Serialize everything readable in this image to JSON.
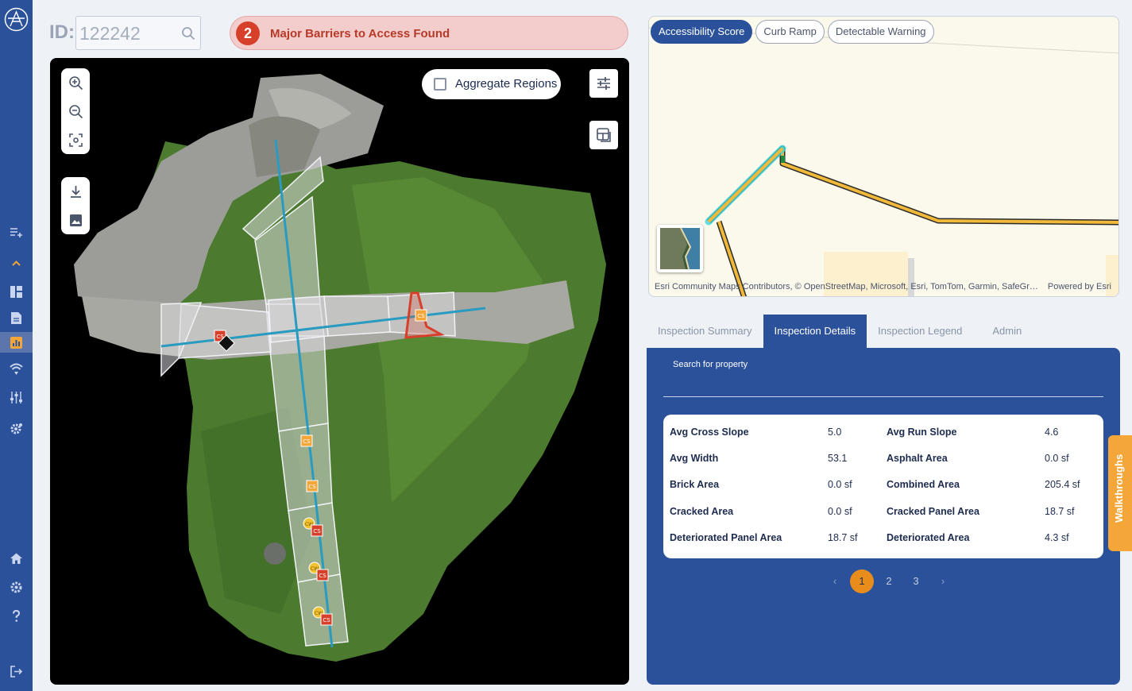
{
  "header": {
    "id_label": "ID:",
    "id_value": "122242",
    "alert_count": "2",
    "alert_text": "Major Barriers to Access Found"
  },
  "sidebar": {
    "items": [
      {
        "icon": "add-list-icon"
      },
      {
        "icon": "chevron-up-icon"
      },
      {
        "icon": "dashboard-icon"
      },
      {
        "icon": "document-icon"
      },
      {
        "icon": "analytics-icon",
        "active": true
      },
      {
        "icon": "wifi-icon"
      },
      {
        "icon": "sliders-icon"
      },
      {
        "icon": "settings-gear-icon"
      },
      {
        "icon": "home-icon"
      },
      {
        "icon": "gear-icon"
      },
      {
        "icon": "help-icon"
      },
      {
        "icon": "logout-icon"
      }
    ]
  },
  "main_map": {
    "aggregate_label": "Aggregate Regions",
    "aggregate_checked": false,
    "markers": [
      "CS",
      "CS",
      "CS",
      "CS",
      "CS",
      "CS",
      "CS",
      "CW",
      "CW",
      "CW"
    ]
  },
  "mini_map": {
    "tabs": [
      {
        "label": "Accessibility Score",
        "active": true
      },
      {
        "label": "Curb Ramp",
        "active": false
      },
      {
        "label": "Detectable Warning",
        "active": false
      }
    ],
    "attribution": "Esri Community Maps Contributors, © OpenStreetMap, Microsoft, Esri, TomTom, Garmin, SafeGra…",
    "powered_by": "Powered by Esri"
  },
  "panel_tabs": [
    {
      "label": "Inspection Summary",
      "active": false
    },
    {
      "label": "Inspection Details",
      "active": true
    },
    {
      "label": "Inspection Legend",
      "active": false
    },
    {
      "label": "Admin",
      "active": false
    }
  ],
  "details": {
    "search_label": "Search for property",
    "rows": [
      {
        "k1": "Avg Cross Slope",
        "v1": "5.0",
        "k2": "Avg Run Slope",
        "v2": "4.6"
      },
      {
        "k1": "Avg Width",
        "v1": "53.1",
        "k2": "Asphalt Area",
        "v2": "0.0 sf"
      },
      {
        "k1": "Brick Area",
        "v1": "0.0 sf",
        "k2": "Combined Area",
        "v2": "205.4 sf"
      },
      {
        "k1": "Cracked Area",
        "v1": "0.0 sf",
        "k2": "Cracked Panel Area",
        "v2": "18.7 sf"
      },
      {
        "k1": "Deteriorated Panel Area",
        "v1": "18.7 sf",
        "k2": "Deteriorated Area",
        "v2": "4.3 sf"
      }
    ],
    "pages": [
      "1",
      "2",
      "3"
    ],
    "current_page": "1",
    "prev_symbol": "‹",
    "next_symbol": "›"
  },
  "walkthroughs_label": "Walkthroughs",
  "colors": {
    "brand": "#2b519b",
    "alert_bg": "#f3cccc",
    "alert_text": "#b73a28",
    "accent_orange": "#e88d1b"
  }
}
